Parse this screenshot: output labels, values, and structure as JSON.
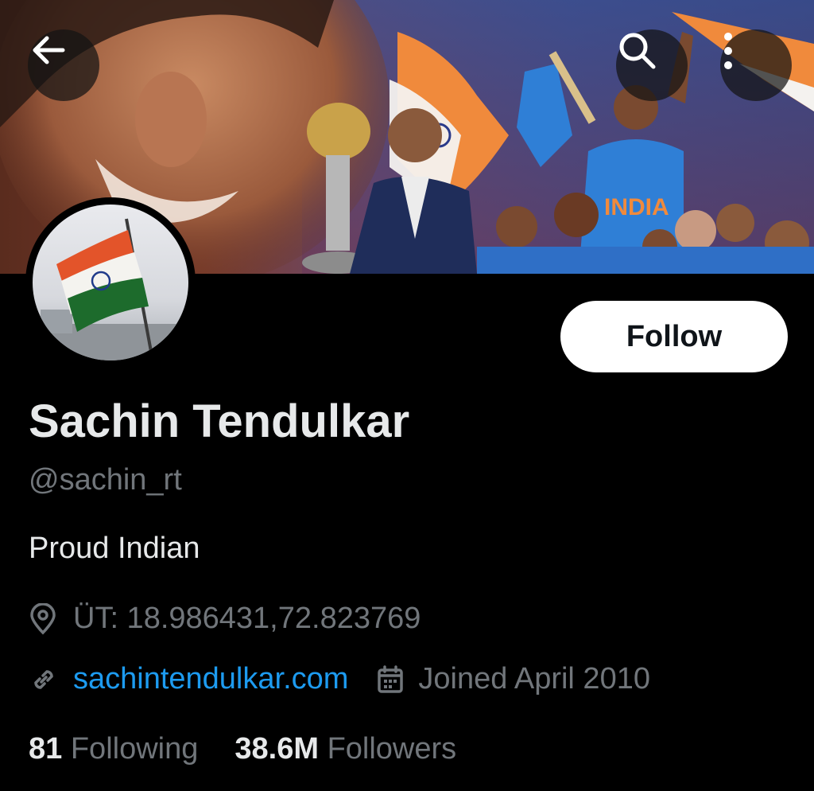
{
  "header": {
    "back_icon": "arrow-left-icon",
    "search_icon": "search-icon",
    "more_icon": "more-vertical-icon"
  },
  "profile": {
    "follow_label": "Follow",
    "name": "Sachin Tendulkar",
    "handle": "@sachin_rt",
    "bio": "Proud Indian",
    "location": "ÜT: 18.986431,72.823769",
    "website": "sachintendulkar.com",
    "joined": "Joined April 2010"
  },
  "stats": {
    "following_count": "81",
    "following_label": "Following",
    "followers_count": "38.6M",
    "followers_label": "Followers"
  },
  "colors": {
    "background": "#000000",
    "text_primary": "#e7e9ea",
    "text_secondary": "#71767b",
    "link": "#1d9bf0",
    "follow_bg": "#ffffff"
  }
}
